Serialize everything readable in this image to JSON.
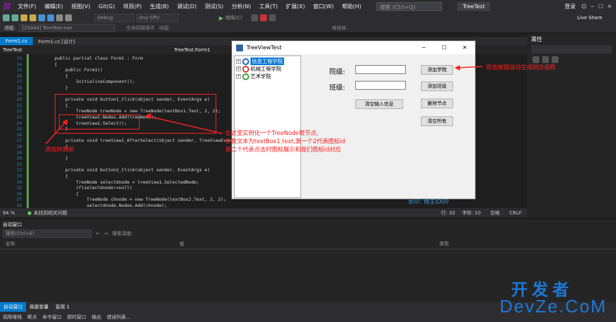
{
  "menubar": {
    "items": [
      "文件(F)",
      "编辑(E)",
      "视图(V)",
      "Git(G)",
      "项目(P)",
      "生成(B)",
      "调试(D)",
      "测试(S)",
      "分析(N)",
      "工具(T)",
      "扩展(X)",
      "窗口(W)",
      "帮助(H)"
    ],
    "search_placeholder": "搜索 (Ctrl+Q)",
    "app_title": "TreeTest",
    "login": "登录",
    "live_share": "Live Share"
  },
  "toolbar": {
    "config": "Debug",
    "platform": "Any CPU",
    "continue": "继续(C)"
  },
  "procbar": {
    "process_label": "进程:",
    "process_value": "[25444] TreeTest.exe",
    "lifecycle": "生命周期事件",
    "thread": "线程:",
    "stack": "堆栈帧:"
  },
  "editor": {
    "tabs": [
      "Form1.cs",
      "Form1.cs [设计]"
    ],
    "nav_left": "TreeTest",
    "nav_mid": "TreeTest.Form1",
    "lines": [
      {
        "n": "13",
        "t": "    public partial class Form1 : Form"
      },
      {
        "n": "14",
        "t": "    {"
      },
      {
        "n": "15",
        "t": "        public Form1()"
      },
      {
        "n": "16",
        "t": "        {"
      },
      {
        "n": "17",
        "t": "            InitializeComponent();"
      },
      {
        "n": "18",
        "t": "        }"
      },
      {
        "n": "19",
        "t": ""
      },
      {
        "n": "20",
        "t": "        private void button1_Click(object sender, EventArgs e)"
      },
      {
        "n": "21",
        "t": "        {"
      },
      {
        "n": "22",
        "t": "            TreeNode treeNode = new TreeNode(textBox1.Text, 2, 2);"
      },
      {
        "n": "23",
        "t": "            treeView1.Nodes.Add(treeNode);"
      },
      {
        "n": "24",
        "t": "            treeView1.Select();"
      },
      {
        "n": "25",
        "t": "        }"
      },
      {
        "n": "26",
        "t": ""
      },
      {
        "n": "27",
        "t": "        private void treeView1_AfterSelect(object sender, TreeViewEventArgs e)"
      },
      {
        "n": "28",
        "t": "        {"
      },
      {
        "n": "29",
        "t": ""
      },
      {
        "n": "30",
        "t": "        }"
      },
      {
        "n": "31",
        "t": ""
      },
      {
        "n": "32",
        "t": "        private void button2_Click(object sender, EventArgs e)"
      },
      {
        "n": "33",
        "t": "        {"
      },
      {
        "n": "34",
        "t": "            TreeNode selectdnode = treeView1.SelectedNode;"
      },
      {
        "n": "35",
        "t": "            if(selectdnode!=null)"
      },
      {
        "n": "36",
        "t": "            {"
      },
      {
        "n": "37",
        "t": "                TreeNode chnode = new TreeNode(textBox2.Text, 2, 2);"
      },
      {
        "n": "38",
        "t": "                selectdnode.Nodes.Add(chnode);"
      }
    ],
    "zoom": "94 %",
    "issues": "未找到相关问题",
    "line_info": "行: 33",
    "col_info": "字符: 10",
    "space": "空格",
    "crlf": "CRLF"
  },
  "properties": {
    "title": "属性"
  },
  "winform": {
    "title": "TreeViewTest",
    "tree_nodes": [
      "信息工程学院",
      "机械工程学院",
      "艺术学院"
    ],
    "label_college": "院级:",
    "label_class": "班级:",
    "btn_add_college": "添加学院",
    "btn_add_class": "添加班级",
    "btn_delete": "删除节点",
    "btn_clear_input": "清空输入信息",
    "btn_clear_all": "清空所有"
  },
  "annotations": {
    "dblclick": "双击按钮自动生成响应函数",
    "instantiate_l1": "在这里实例化一个TreeNode根节点,",
    "instantiate_l2": "参数文本为textBox1.text,第一个2代表图标id",
    "instantiate_l3": "第二个代表点击时图标展示和我们图标id对应",
    "refresh": "添加并刷新",
    "watermark_code": "水印: 博主ID00"
  },
  "autos": {
    "title": "自动窗口",
    "search_placeholder": "搜索(Ctrl+E)",
    "depth": "搜索深度:",
    "col_name": "名称",
    "col_value": "值",
    "col_type": "类型"
  },
  "bottom_tabs": [
    "自动窗口",
    "局部变量",
    "监视 1"
  ],
  "status_items": [
    "调用堆栈",
    "断点",
    "命令窗口",
    "即时窗口",
    "输出",
    "错误列表..."
  ],
  "watermark": {
    "cn": "开发者",
    "en": "DevZe.CoM"
  }
}
